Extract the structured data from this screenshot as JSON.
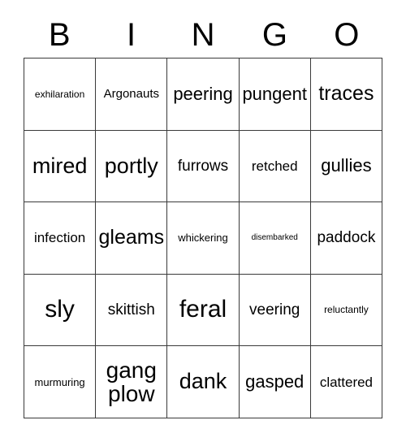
{
  "card": {
    "title": "BINGO",
    "header_letters": [
      "B",
      "I",
      "N",
      "G",
      "O"
    ],
    "columns": 5,
    "rows": 5,
    "grid_line_color": "#3a3a3a",
    "text_color": "#000000",
    "background_color": "#ffffff",
    "cells": [
      [
        {
          "text": "exhilaration",
          "size": "sm"
        },
        {
          "text": "Argonauts",
          "size": "md"
        },
        {
          "text": "peering",
          "size": "xl"
        },
        {
          "text": "pungent",
          "size": "xl"
        },
        {
          "text": "traces",
          "size": "2xl"
        }
      ],
      [
        {
          "text": "mired",
          "size": "3xl"
        },
        {
          "text": "portly",
          "size": "3xl"
        },
        {
          "text": "furrows",
          "size": "lg"
        },
        {
          "text": "retched",
          "size": "mdp"
        },
        {
          "text": "gullies",
          "size": "xl"
        }
      ],
      [
        {
          "text": "infection",
          "size": "mdp"
        },
        {
          "text": "gleams",
          "size": "2xl"
        },
        {
          "text": "whickering",
          "size": "smp"
        },
        {
          "text": "disembarked",
          "size": "xs"
        },
        {
          "text": "paddock",
          "size": "lg"
        }
      ],
      [
        {
          "text": "sly",
          "size": "4xl"
        },
        {
          "text": "skittish",
          "size": "lg"
        },
        {
          "text": "feral",
          "size": "4xl"
        },
        {
          "text": "veering",
          "size": "lg"
        },
        {
          "text": "reluctantly",
          "size": "sm"
        }
      ],
      [
        {
          "text": "murmuring",
          "size": "smp"
        },
        {
          "text": "gang plow",
          "size": "wrap"
        },
        {
          "text": "dank",
          "size": "3xl"
        },
        {
          "text": "gasped",
          "size": "xl"
        },
        {
          "text": "clattered",
          "size": "mdp"
        }
      ]
    ]
  }
}
